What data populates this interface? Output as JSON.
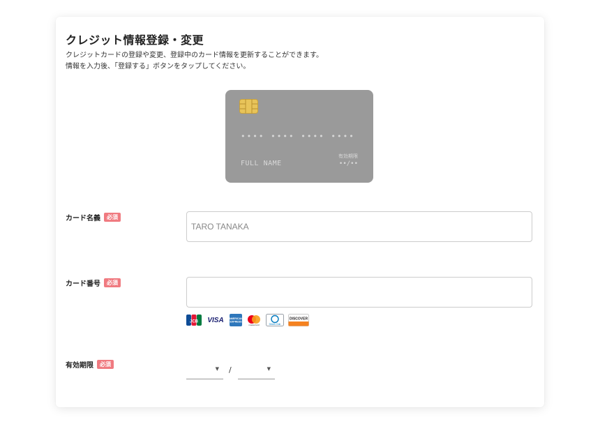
{
  "page": {
    "title": "クレジット情報登録・変更",
    "description_line1": "クレジットカードの登録や変更、登録中のカード情報を更新することができます。",
    "description_line2": "情報を入力後、「登録する」ボタンをタップしてください。"
  },
  "card_preview": {
    "number": "•••• •••• •••• ••••",
    "name": "FULL NAME",
    "expiry_label": "有効期限",
    "expiry": "••/••",
    "background_color": "#9a9a9a"
  },
  "form": {
    "required_badge": "必須",
    "card_name": {
      "label": "カード名義",
      "placeholder": "TARO TANAKA",
      "value": ""
    },
    "card_number": {
      "label": "カード番号",
      "placeholder": "",
      "value": ""
    },
    "brands": {
      "jcb": "JCB",
      "visa": "VISA",
      "amex": "AMERICAN EXPRESS",
      "mastercard": "mastercard",
      "diners": "Diners Club",
      "discover": "DISCOVER"
    },
    "expiry": {
      "label": "有効期限",
      "separator": "/",
      "month_value": "",
      "year_value": ""
    }
  },
  "colors": {
    "required_badge": "#f07a80",
    "card_chip": "#e8c45a"
  }
}
